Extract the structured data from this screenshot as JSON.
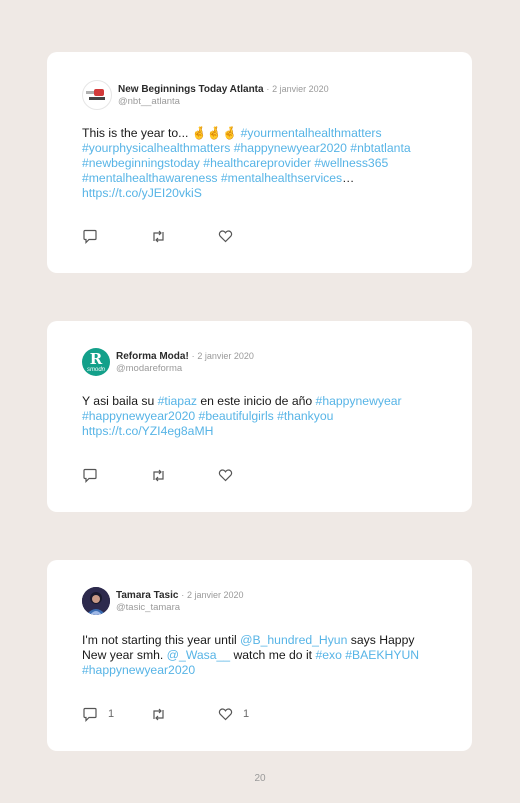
{
  "tweets": [
    {
      "name": "New Beginnings Today Atlanta",
      "date": "2 janvier 2020",
      "handle": "@nbt__atlanta",
      "text": [
        {
          "t": "This is the year to... 🤞🤞🤞 ",
          "link": false
        },
        {
          "t": "#yourmentalhealthmatters #yourphysicalhealthmatters #happynewyear2020 #nbtatlanta #newbeginningstoday #healthcareprovider #wellness365 #mentalhealthawareness #mentalhealthservices",
          "link": true
        },
        {
          "t": "… ",
          "link": false
        },
        {
          "t": "https://t.co/yJEI20vkiS",
          "link": true
        }
      ],
      "reply_count": "",
      "like_count": ""
    },
    {
      "name": "Reforma Moda!",
      "date": "2 janvier 2020",
      "handle": "@modareforma",
      "avatar_text": "R",
      "avatar_subtext": "smodn",
      "text": [
        {
          "t": "Y asi baila su ",
          "link": false
        },
        {
          "t": "#tiapaz",
          "link": true
        },
        {
          "t": " en este inicio de año ",
          "link": false
        },
        {
          "t": "#happynewyear #happynewyear2020 #beautifulgirls #thankyou https://t.co/YZI4eg8aMH",
          "link": true
        }
      ],
      "reply_count": "",
      "like_count": ""
    },
    {
      "name": "Tamara Tasic",
      "date": "2 janvier 2020",
      "handle": "@tasic_tamara",
      "text": [
        {
          "t": "I'm not starting this year until ",
          "link": false
        },
        {
          "t": "@B_hundred_Hyun",
          "link": true
        },
        {
          "t": " says Happy New year smh. ",
          "link": false
        },
        {
          "t": "@_Wasa__",
          "link": true
        },
        {
          "t": " watch me do it ",
          "link": false
        },
        {
          "t": "#exo #BAEKHYUN #happynewyear2020",
          "link": true
        }
      ],
      "reply_count": "1",
      "like_count": "1"
    }
  ],
  "separator": "·",
  "page_number": "20",
  "colors": {
    "link": "#57b4e6",
    "background": "#efe9e5",
    "card": "#ffffff"
  },
  "icons": [
    "reply-icon",
    "retweet-icon",
    "like-icon"
  ]
}
